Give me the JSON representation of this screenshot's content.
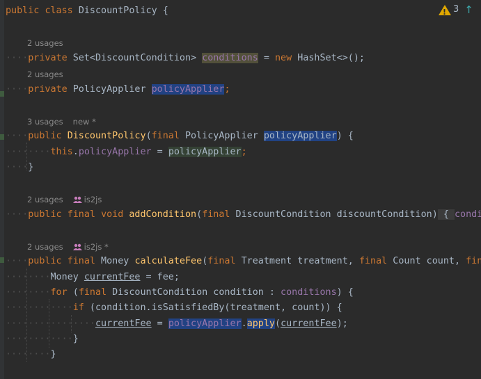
{
  "editor": {
    "class_decl": {
      "kw_public": "public",
      "kw_class": "class",
      "name": "DiscountPolicy",
      "brace": " {"
    },
    "inspections": {
      "warning_count": "3"
    },
    "field1": {
      "usages": "2 usages",
      "kw_private": "private",
      "type": "Set<DiscountCondition>",
      "name": "conditions",
      "rest1": " = ",
      "kw_new": "new",
      "rest2": " HashSet<>();"
    },
    "field2": {
      "usages": "2 usages",
      "kw_private": "private",
      "type": "PolicyApplier",
      "name": "policyApplier",
      "semi": ";"
    },
    "constructor": {
      "usages": "3 usages",
      "author": "new *",
      "kw_public": "public",
      "name": "DiscountPolicy",
      "open": "(",
      "kw_final": "final",
      "ptype": " PolicyApplier ",
      "pname": "policyApplier",
      "close": ") {",
      "body_this": "this",
      "body_dot": ".",
      "body_field": "policyApplier",
      "body_eq": " = ",
      "body_val": "policyApplier",
      "body_semi": ";",
      "end": "}"
    },
    "addCondition": {
      "usages": "2 usages",
      "author": "is2js",
      "kw_public": "public",
      "kw_final": "final",
      "kw_void": "void",
      "name": "addCondition",
      "open": "(",
      "p_final": "final",
      "params": " DiscountCondition discountCondition",
      "close": ")",
      "folded": " { ",
      "folded_field": "condit"
    },
    "calculateFee": {
      "usages": "2 usages",
      "author": "is2js *",
      "kw_public": "public",
      "kw_final": "final",
      "rtype": " Money ",
      "name": "calculateFee",
      "open": "(",
      "p1_final": "final",
      "p1": " Treatment treatment, ",
      "p2_final": "final",
      "p2": " Count count, ",
      "p3_final": "fina",
      "l1_type": "Money ",
      "l1_var": "currentFee",
      "l1_rest": " = fee;",
      "l2_for": "for",
      "l2_open": " (",
      "l2_final": "final",
      "l2_decl": " DiscountCondition condition : ",
      "l2_field": "conditions",
      "l2_close": ") {",
      "l3_if": "if",
      "l3_rest": " (condition.isSatisfiedBy(treatment, count)) {",
      "l4_var": "currentFee",
      "l4_eq": " = ",
      "l4_field": "policyApplier",
      "l4_dot": ".",
      "l4_call": "apply",
      "l4_open": "(",
      "l4_arg": "currentFee",
      "l4_close": ");",
      "l5": "}",
      "l6": "}"
    }
  },
  "colors": {
    "background": "#2b2b2b",
    "keyword": "#cc7832",
    "method": "#ffc66d",
    "field": "#9876aa",
    "text": "#a9b7c6",
    "highlight_usage": "#214283",
    "highlight_write": "#344134",
    "warning": "#e0a800",
    "arrow": "#3ea8ab"
  },
  "icons": [
    "warning-icon",
    "arrow-up-icon",
    "user-group-icon"
  ]
}
